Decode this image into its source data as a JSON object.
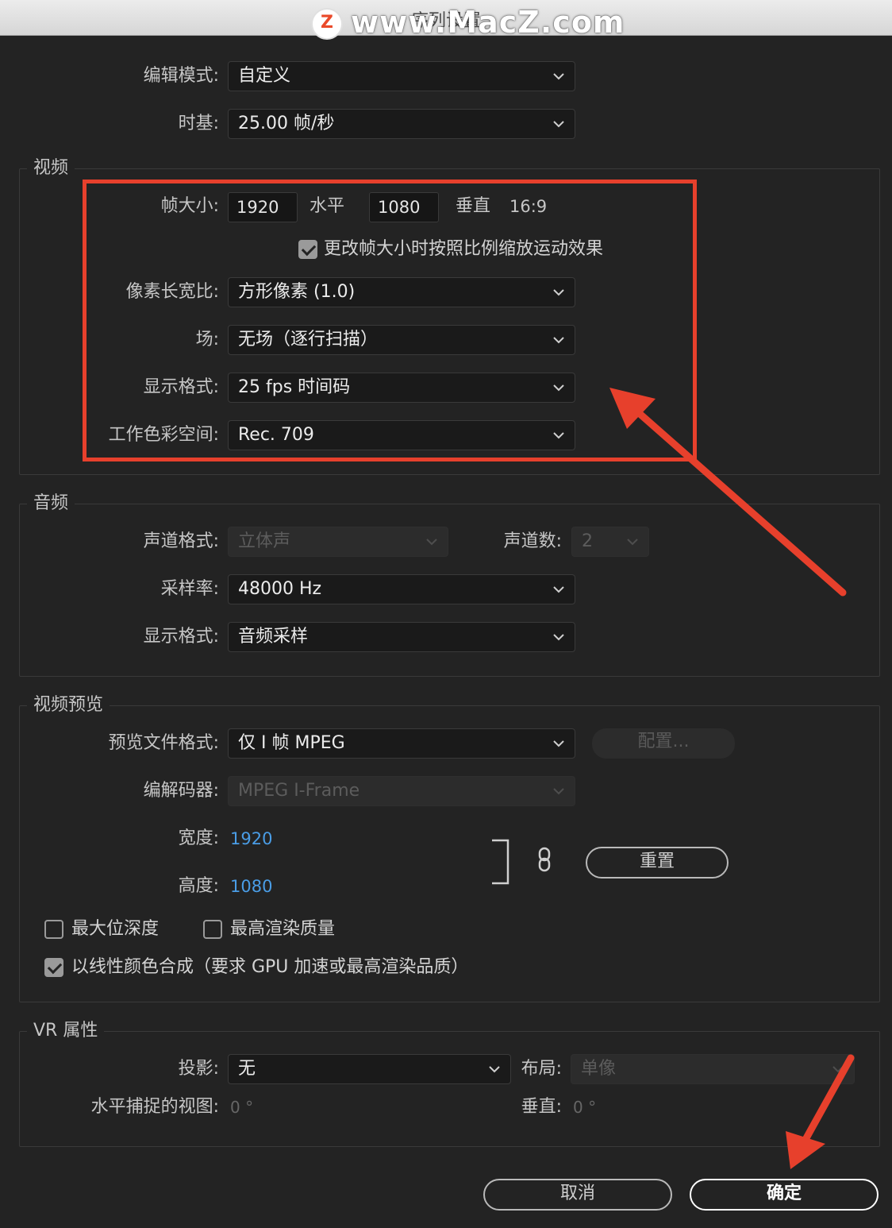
{
  "window": {
    "title": "序列设置",
    "watermark": "www.MacZ.com",
    "watermark_logo": "Z"
  },
  "general": {
    "edit_mode_label": "编辑模式:",
    "edit_mode_value": "自定义",
    "timebase_label": "时基:",
    "timebase_value": "25.00  帧/秒"
  },
  "video": {
    "title": "视频",
    "frame_size_label": "帧大小:",
    "width": "1920",
    "horizontal_label": "水平",
    "height": "1080",
    "vertical_label": "垂直",
    "aspect": "16:9",
    "scale_checkbox_label": "更改帧大小时按照比例缩放运动效果",
    "scale_checked": true,
    "pixel_aspect_label": "像素长宽比:",
    "pixel_aspect_value": "方形像素 (1.0)",
    "fields_label": "场:",
    "fields_value": "无场（逐行扫描）",
    "display_format_label": "显示格式:",
    "display_format_value": "25 fps 时间码",
    "color_space_label": "工作色彩空间:",
    "color_space_value": "Rec. 709"
  },
  "audio": {
    "title": "音频",
    "channel_format_label": "声道格式:",
    "channel_format_value": "立体声",
    "channels_label": "声道数:",
    "channels_value": "2",
    "sample_rate_label": "采样率:",
    "sample_rate_value": "48000 Hz",
    "display_format_label": "显示格式:",
    "display_format_value": "音频采样"
  },
  "preview": {
    "title": "视频预览",
    "file_format_label": "预览文件格式:",
    "file_format_value": "仅 I 帧 MPEG",
    "configure_button": "配置...",
    "codec_label": "编解码器:",
    "codec_value": "MPEG I-Frame",
    "width_label": "宽度:",
    "width_value": "1920",
    "height_label": "高度:",
    "height_value": "1080",
    "reset_button": "重置",
    "max_bit_depth_label": "最大位深度",
    "max_bit_depth_checked": false,
    "max_render_quality_label": "最高渲染质量",
    "max_render_quality_checked": false,
    "linear_color_label": "以线性颜色合成（要求 GPU 加速或最高渲染品质）",
    "linear_color_checked": true
  },
  "vr": {
    "title": "VR 属性",
    "projection_label": "投影:",
    "projection_value": "无",
    "layout_label": "布局:",
    "layout_value": "单像",
    "h_view_label": "水平捕捉的视图:",
    "h_view_value": "0 °",
    "v_label": "垂直:",
    "v_value": "0 °"
  },
  "buttons": {
    "cancel": "取消",
    "ok": "确定"
  },
  "annotation_color": "#e7402c"
}
